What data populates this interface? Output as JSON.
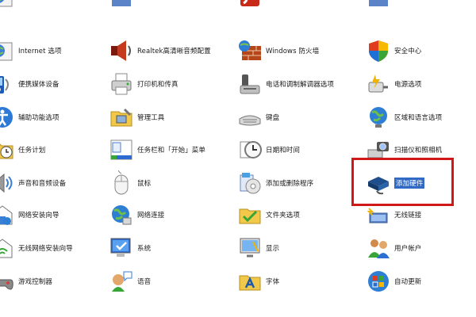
{
  "top_row": [
    {
      "label": "Internet 选项",
      "icon": "internet-options-icon"
    },
    {
      "label": "",
      "icon": "unknown-icon"
    },
    {
      "label": "",
      "icon": "flash-icon"
    },
    {
      "label": "",
      "icon": "unknown-icon"
    }
  ],
  "items": [
    {
      "label": "Internet 选项",
      "icon": "internet-options-icon"
    },
    {
      "label": "Realtek高清晰音频配置",
      "icon": "speaker-icon"
    },
    {
      "label": "Windows 防火墙",
      "icon": "firewall-icon"
    },
    {
      "label": "安全中心",
      "icon": "shield-icon"
    },
    {
      "label": "便携媒体设备",
      "icon": "portable-media-icon"
    },
    {
      "label": "打印机和传真",
      "icon": "printer-icon"
    },
    {
      "label": "电话和调制解调器选项",
      "icon": "phone-modem-icon"
    },
    {
      "label": "电源选项",
      "icon": "power-icon"
    },
    {
      "label": "辅助功能选项",
      "icon": "accessibility-icon"
    },
    {
      "label": "管理工具",
      "icon": "admin-tools-icon"
    },
    {
      "label": "键盘",
      "icon": "keyboard-icon"
    },
    {
      "label": "区域和语言选项",
      "icon": "globe-icon"
    },
    {
      "label": "任务计划",
      "icon": "scheduled-tasks-icon"
    },
    {
      "label": "任务栏和「开始」菜单",
      "icon": "taskbar-icon"
    },
    {
      "label": "日期和时间",
      "icon": "clock-icon"
    },
    {
      "label": "扫描仪和照相机",
      "icon": "scanner-camera-icon"
    },
    {
      "label": "声音和音频设备",
      "icon": "sound-icon"
    },
    {
      "label": "鼠标",
      "icon": "mouse-icon"
    },
    {
      "label": "添加或删除程序",
      "icon": "add-remove-programs-icon"
    },
    {
      "label": "添加硬件",
      "icon": "add-hardware-icon"
    },
    {
      "label": "网络安装向导",
      "icon": "network-setup-icon"
    },
    {
      "label": "网络连接",
      "icon": "network-connections-icon"
    },
    {
      "label": "文件夹选项",
      "icon": "folder-options-icon"
    },
    {
      "label": "无线链接",
      "icon": "wireless-link-icon"
    },
    {
      "label": "无线网络安装向导",
      "icon": "wireless-network-icon"
    },
    {
      "label": "系统",
      "icon": "system-icon"
    },
    {
      "label": "显示",
      "icon": "display-icon"
    },
    {
      "label": "用户帐户",
      "icon": "user-accounts-icon"
    },
    {
      "label": "游戏控制器",
      "icon": "game-controller-icon"
    },
    {
      "label": "语音",
      "icon": "speech-icon"
    },
    {
      "label": "字体",
      "icon": "fonts-icon"
    },
    {
      "label": "自动更新",
      "icon": "windows-update-icon"
    }
  ],
  "selected_index": 19,
  "colors": {
    "highlight": "#d01818",
    "selection": "#316ac5"
  }
}
